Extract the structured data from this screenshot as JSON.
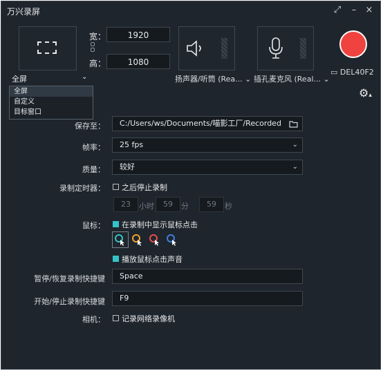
{
  "window": {
    "title": "万兴录屏",
    "controls": {
      "restore": "⤢",
      "minimize": "–",
      "close": "×"
    }
  },
  "capture": {
    "mode_label": "全屏",
    "width_label": "宽：",
    "height_label": "高：",
    "width_value": "1920",
    "height_value": "1080",
    "mode_options": [
      "全屏",
      "自定义",
      "目标窗口"
    ]
  },
  "audio": {
    "speaker_label": "扬声器/听筒 (Rea...",
    "mic_label": "插孔麦克风 (Real...",
    "speaker_icon": "speaker-icon",
    "mic_icon": "microphone-icon"
  },
  "record": {
    "monitor_label": "DEL40F2",
    "record_color": "#f0433f"
  },
  "settings": {
    "save_to_label": "保存至：",
    "save_path": "C:/Users/ws/Documents/喵影工厂/Recorded",
    "fps_label": "帧率：",
    "fps_value": "25 fps",
    "quality_label": "质量：",
    "quality_value": "较好",
    "timer_label": "录制定时器：",
    "timer_checkbox_label": "之后停止录制",
    "timer_hours": "23",
    "timer_hours_unit": "小时",
    "timer_minutes": "59",
    "timer_minutes_unit": "分",
    "timer_seconds": "59",
    "timer_seconds_unit": "秒",
    "mouse_label": "鼠标：",
    "show_clicks_label": "在录制中显示鼠标点击",
    "cursor_colors": [
      "#35c3c9",
      "#f0a030",
      "#e8504a",
      "#3f7fe0"
    ],
    "click_sound_label": "播放鼠标点击声音",
    "pause_hotkey_label": "暂停/恢复录制快捷键",
    "pause_hotkey_value": "Space",
    "start_hotkey_label": "开始/停止录制快捷键",
    "start_hotkey_value": "F9",
    "camera_label": "相机：",
    "camera_checkbox_label": "记录网络录像机"
  },
  "accent": "#35c3c9"
}
